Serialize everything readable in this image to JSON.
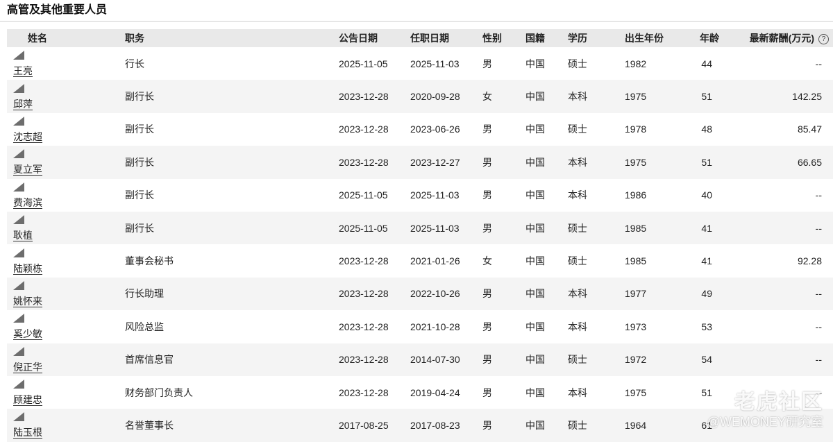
{
  "section": {
    "title": "高管及其他重要人员"
  },
  "table": {
    "headers": {
      "name": "姓名",
      "position": "职务",
      "announce_date": "公告日期",
      "appoint_date": "任职日期",
      "gender": "性别",
      "nationality": "国籍",
      "education": "学历",
      "birth_year": "出生年份",
      "age": "年龄",
      "salary": "最新薪酬(万元)"
    },
    "help_icon_glyph": "?",
    "rows": [
      {
        "name": "王亮",
        "position": "行长",
        "announce_date": "2025-11-05",
        "appoint_date": "2025-11-03",
        "gender": "男",
        "nationality": "中国",
        "education": "硕士",
        "birth_year": "1982",
        "age": "44",
        "salary": "--"
      },
      {
        "name": "邱萍",
        "position": "副行长",
        "announce_date": "2023-12-28",
        "appoint_date": "2020-09-28",
        "gender": "女",
        "nationality": "中国",
        "education": "本科",
        "birth_year": "1975",
        "age": "51",
        "salary": "142.25"
      },
      {
        "name": "沈志超",
        "position": "副行长",
        "announce_date": "2023-12-28",
        "appoint_date": "2023-06-26",
        "gender": "男",
        "nationality": "中国",
        "education": "硕士",
        "birth_year": "1978",
        "age": "48",
        "salary": "85.47"
      },
      {
        "name": "夏立军",
        "position": "副行长",
        "announce_date": "2023-12-28",
        "appoint_date": "2023-12-27",
        "gender": "男",
        "nationality": "中国",
        "education": "本科",
        "birth_year": "1975",
        "age": "51",
        "salary": "66.65"
      },
      {
        "name": "费海滨",
        "position": "副行长",
        "announce_date": "2025-11-05",
        "appoint_date": "2025-11-03",
        "gender": "男",
        "nationality": "中国",
        "education": "本科",
        "birth_year": "1986",
        "age": "40",
        "salary": "--"
      },
      {
        "name": "耿植",
        "position": "副行长",
        "announce_date": "2025-11-05",
        "appoint_date": "2025-11-03",
        "gender": "男",
        "nationality": "中国",
        "education": "硕士",
        "birth_year": "1985",
        "age": "41",
        "salary": "--"
      },
      {
        "name": "陆颖栋",
        "position": "董事会秘书",
        "announce_date": "2023-12-28",
        "appoint_date": "2021-01-26",
        "gender": "女",
        "nationality": "中国",
        "education": "硕士",
        "birth_year": "1985",
        "age": "41",
        "salary": "92.28"
      },
      {
        "name": "姚怀来",
        "position": "行长助理",
        "announce_date": "2023-12-28",
        "appoint_date": "2022-10-26",
        "gender": "男",
        "nationality": "中国",
        "education": "本科",
        "birth_year": "1977",
        "age": "49",
        "salary": "--"
      },
      {
        "name": "奚少敏",
        "position": "风险总监",
        "announce_date": "2023-12-28",
        "appoint_date": "2021-10-28",
        "gender": "男",
        "nationality": "中国",
        "education": "本科",
        "birth_year": "1973",
        "age": "53",
        "salary": "--"
      },
      {
        "name": "倪正华",
        "position": "首席信息官",
        "announce_date": "2023-12-28",
        "appoint_date": "2014-07-30",
        "gender": "男",
        "nationality": "中国",
        "education": "硕士",
        "birth_year": "1972",
        "age": "54",
        "salary": "--"
      },
      {
        "name": "顾建忠",
        "position": "财务部门负责人",
        "announce_date": "2023-12-28",
        "appoint_date": "2019-04-24",
        "gender": "男",
        "nationality": "中国",
        "education": "本科",
        "birth_year": "1975",
        "age": "51",
        "salary": "--"
      },
      {
        "name": "陆玉根",
        "position": "名誉董事长",
        "announce_date": "2017-08-25",
        "appoint_date": "2017-08-23",
        "gender": "男",
        "nationality": "中国",
        "education": "硕士",
        "birth_year": "1964",
        "age": "61",
        "salary": "--"
      }
    ]
  },
  "watermark": {
    "logo_text": "老虎社区",
    "sub_text": "@WEMONEY研究室"
  }
}
